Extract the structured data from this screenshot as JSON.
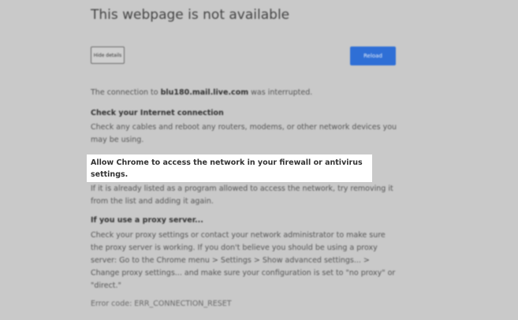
{
  "page": {
    "title": "This webpage is not available",
    "hide_details_label": "Hide details",
    "reload_label": "Reload",
    "connection_prefix": "The connection to ",
    "connection_host": "blu180.mail.live.com",
    "connection_suffix": " was interrupted.",
    "sections": [
      {
        "heading": "Check your Internet connection",
        "body": "Check any cables and reboot any routers, modems, or other network devices you may be using."
      },
      {
        "heading": "Allow Chrome to access the network in your firewall or antivirus settings.",
        "body": "If it is already listed as a program allowed to access the network, try removing it from the list and adding it again."
      },
      {
        "heading": "If you use a proxy server...",
        "body": "Check your proxy settings or contact your network administrator to make sure the proxy server is working. If you don't believe you should be using a proxy server: Go to the Chrome menu > Settings > Show advanced settings... > Change proxy settings... and make sure your configuration is set to \"no proxy\" or \"direct.\""
      }
    ],
    "error_code": "Error code: ERR_CONNECTION_RESET"
  },
  "colors": {
    "background": "#c9c9c9",
    "reload_button": "#2f6fd6",
    "highlight": "#ffffff"
  }
}
